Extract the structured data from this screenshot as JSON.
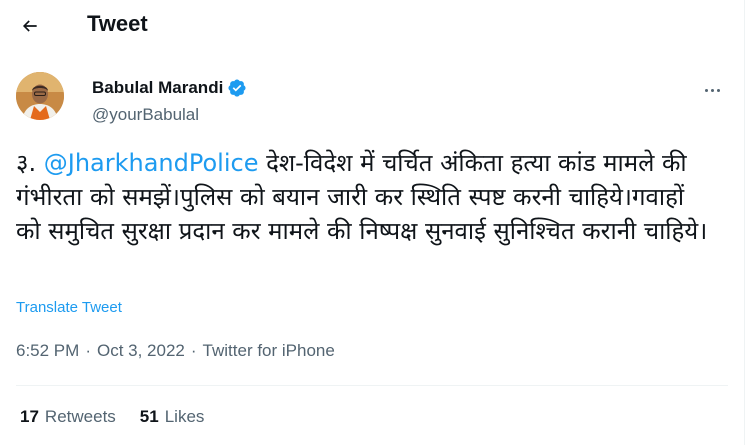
{
  "header": {
    "title": "Tweet",
    "back_icon": "arrow-left-icon"
  },
  "author": {
    "display_name": "Babulal Marandi",
    "handle": "@yourBabulal",
    "verified_icon": "verified-badge-icon",
    "verified_color": "#1d9bf0"
  },
  "tweet": {
    "text_before": "३. ",
    "mention": "@JharkhandPolice",
    "text_after": " देश-विदेश में चर्चित अंकिता हत्या कांड मामले की गंभीरता को समझें।पुलिस को बयान जारी कर स्थिति स्पष्ट करनी चाहिये।गवाहों को समुचित सुरक्षा प्रदान कर मामले की निष्पक्ष सुनवाई सुनिश्चित करानी चाहिये।",
    "translate_label": "Translate Tweet"
  },
  "meta": {
    "time": "6:52 PM",
    "separator": "·",
    "date": "Oct 3, 2022",
    "source": "Twitter for iPhone"
  },
  "stats": {
    "retweets_count": "17",
    "retweets_label": "Retweets",
    "likes_count": "51",
    "likes_label": "Likes"
  },
  "colors": {
    "accent": "#1d9bf0",
    "text": "#0f1419",
    "secondary": "#536471",
    "border": "#eff3f4"
  }
}
